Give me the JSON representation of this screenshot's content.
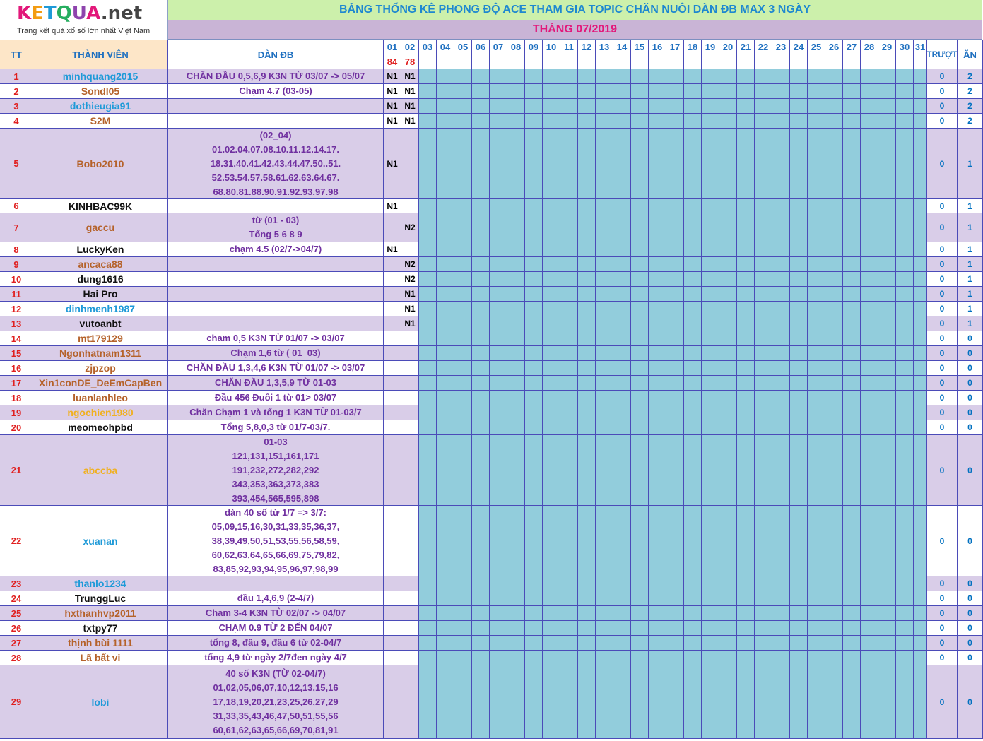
{
  "logo": {
    "brand": "KETQUA.net",
    "tagline": "Trang kết quả xổ số lớn nhất Việt Nam"
  },
  "title": "BẢNG THỐNG KÊ PHONG ĐỘ ACE THAM GIA TOPIC CHĂN NUÔI DÀN ĐB MAX 3 NGÀY",
  "month": "THÁNG 07/2019",
  "headers": {
    "tt": "TT",
    "member": "THÀNH VIÊN",
    "dan": "DÀN ĐB",
    "truot": "TRƯỢT",
    "an": "ĂN"
  },
  "days": [
    "01",
    "02",
    "03",
    "04",
    "05",
    "06",
    "07",
    "08",
    "09",
    "10",
    "11",
    "12",
    "13",
    "14",
    "15",
    "16",
    "17",
    "18",
    "19",
    "20",
    "21",
    "22",
    "23",
    "24",
    "25",
    "26",
    "27",
    "28",
    "29",
    "30",
    "31"
  ],
  "day_results": [
    "84",
    "78"
  ],
  "colors": {
    "title_bg": "#ccf0ab",
    "month_bg": "#c9b4d6",
    "header_bg": "#fde6c8",
    "result_bg": "#92cddc",
    "row_lavender": "#d9cde8",
    "row_white": "#ffffff",
    "grid_line": "#4b4bb8"
  },
  "rows": [
    {
      "tt": "1",
      "member": "minhquang2015",
      "member_color": "#1e9ad8",
      "dan": [
        "CHĂN ĐẦU 0,5,6,9 K3N TỪ 03/07 -> 05/07"
      ],
      "d1": "N1",
      "d2": "N1",
      "truot": "0",
      "an": "2"
    },
    {
      "tt": "2",
      "member": "Sondl05",
      "member_color": "#b5622a",
      "dan": [
        "Chạm 4.7 (03-05)"
      ],
      "d1": "N1",
      "d2": "N1",
      "truot": "0",
      "an": "2"
    },
    {
      "tt": "3",
      "member": "dothieugia91",
      "member_color": "#1e9ad8",
      "dan": [],
      "d1": "N1",
      "d2": "N1",
      "truot": "0",
      "an": "2"
    },
    {
      "tt": "4",
      "member": "S2M",
      "member_color": "#b5622a",
      "dan": [],
      "d1": "N1",
      "d2": "N1",
      "truot": "0",
      "an": "2"
    },
    {
      "tt": "5",
      "member": "Bobo2010",
      "member_color": "#b5622a",
      "dan": [
        "(02_04)",
        "01.02.04.07.08.10.11.12.14.17.",
        "18.31.40.41.42.43.44.47.50..51.",
        "52.53.54.57.58.61.62.63.64.67.",
        "68.80.81.88.90.91.92.93.97.98"
      ],
      "d1": "N1",
      "d2": "",
      "truot": "0",
      "an": "1"
    },
    {
      "tt": "6",
      "member": "KINHBAC99K",
      "member_color": "#111111",
      "dan": [],
      "d1": "N1",
      "d2": "",
      "truot": "0",
      "an": "1"
    },
    {
      "tt": "7",
      "member": "gaccu",
      "member_color": "#b5622a",
      "dan": [
        "từ (01 - 03)",
        "Tổng 5 6 8 9"
      ],
      "d1": "",
      "d2": "N2",
      "truot": "0",
      "an": "1"
    },
    {
      "tt": "8",
      "member": "LuckyKen",
      "member_color": "#111111",
      "dan": [
        "chạm 4.5 (02/7->04/7)"
      ],
      "d1": "N1",
      "d2": "",
      "truot": "0",
      "an": "1"
    },
    {
      "tt": "9",
      "member": "ancaca88",
      "member_color": "#b5622a",
      "dan": [],
      "d1": "",
      "d2": "N2",
      "truot": "0",
      "an": "1"
    },
    {
      "tt": "10",
      "member": "dung1616",
      "member_color": "#111111",
      "dan": [],
      "d1": "",
      "d2": "N2",
      "truot": "0",
      "an": "1"
    },
    {
      "tt": "11",
      "member": "Hai Pro",
      "member_color": "#111111",
      "dan": [],
      "d1": "",
      "d2": "N1",
      "truot": "0",
      "an": "1"
    },
    {
      "tt": "12",
      "member": "dinhmenh1987",
      "member_color": "#1e9ad8",
      "dan": [],
      "d1": "",
      "d2": "N1",
      "truot": "0",
      "an": "1"
    },
    {
      "tt": "13",
      "member": "vutoanbt",
      "member_color": "#111111",
      "dan": [],
      "d1": "",
      "d2": "N1",
      "truot": "0",
      "an": "1"
    },
    {
      "tt": "14",
      "member": "mt179129",
      "member_color": "#b5622a",
      "dan": [
        "cham 0,5 K3N TỪ 01/07 -> 03/07"
      ],
      "d1": "",
      "d2": "",
      "truot": "0",
      "an": "0"
    },
    {
      "tt": "15",
      "member": "Ngonhatnam1311",
      "member_color": "#b5622a",
      "dan": [
        "Chạm 1,6 từ ( 01_03)"
      ],
      "d1": "",
      "d2": "",
      "truot": "0",
      "an": "0"
    },
    {
      "tt": "16",
      "member": "zjpzop",
      "member_color": "#b5622a",
      "dan": [
        "CHĂN ĐẦU 1,3,4,6 K3N TỪ 01/07 -> 03/07"
      ],
      "d1": "",
      "d2": "",
      "truot": "0",
      "an": "0"
    },
    {
      "tt": "17",
      "member": "Xin1conDE_DeEmCapBen",
      "member_color": "#b5622a",
      "dan": [
        "CHĂN ĐẦU 1,3,5,9 TỪ 01-03"
      ],
      "d1": "",
      "d2": "",
      "truot": "0",
      "an": "0"
    },
    {
      "tt": "18",
      "member": "luanlanhleo",
      "member_color": "#b5622a",
      "dan": [
        "Đầu 456 Đuôi 1 từ 01> 03/07"
      ],
      "d1": "",
      "d2": "",
      "truot": "0",
      "an": "0"
    },
    {
      "tt": "19",
      "member": "ngochien1980",
      "member_color": "#f0b020",
      "dan": [
        "Chăn Chạm 1 và tổng 1 K3N TỪ 01-03/7"
      ],
      "d1": "",
      "d2": "",
      "truot": "0",
      "an": "0"
    },
    {
      "tt": "20",
      "member": "meomeohpbd",
      "member_color": "#111111",
      "dan": [
        "Tổng 5,8,0,3 từ 01/7-03/7."
      ],
      "d1": "",
      "d2": "",
      "truot": "0",
      "an": "0"
    },
    {
      "tt": "21",
      "member": "abccba",
      "member_color": "#f0b020",
      "dan": [
        "01-03",
        "121,131,151,161,171",
        "191,232,272,282,292",
        "343,353,363,373,383",
        "393,454,565,595,898"
      ],
      "d1": "",
      "d2": "",
      "truot": "0",
      "an": "0"
    },
    {
      "tt": "22",
      "member": "xuanan",
      "member_color": "#1e9ad8",
      "dan": [
        "dàn 40 số từ 1/7 => 3/7:",
        "05,09,15,16,30,31,33,35,36,37,",
        "38,39,49,50,51,53,55,56,58,59,",
        "60,62,63,64,65,66,69,75,79,82,",
        "83,85,92,93,94,95,96,97,98,99"
      ],
      "d1": "",
      "d2": "",
      "truot": "0",
      "an": "0"
    },
    {
      "tt": "23",
      "member": "thanlo1234",
      "member_color": "#1e9ad8",
      "dan": [],
      "d1": "",
      "d2": "",
      "truot": "0",
      "an": "0"
    },
    {
      "tt": "24",
      "member": "TrunggLuc",
      "member_color": "#111111",
      "dan": [
        "đầu 1,4,6,9 (2-4/7)"
      ],
      "d1": "",
      "d2": "",
      "truot": "0",
      "an": "0"
    },
    {
      "tt": "25",
      "member": "hxthanhvp2011",
      "member_color": "#b5622a",
      "dan": [
        "Cham 3-4 K3N TỪ 02/07 -> 04/07"
      ],
      "d1": "",
      "d2": "",
      "truot": "0",
      "an": "0"
    },
    {
      "tt": "26",
      "member": "txtpy77",
      "member_color": "#111111",
      "dan": [
        "CHẠM 0.9 TỪ 2 ĐẾN 04/07"
      ],
      "d1": "",
      "d2": "",
      "truot": "0",
      "an": "0"
    },
    {
      "tt": "27",
      "member": "thịnh bùi 1111",
      "member_color": "#b5622a",
      "dan": [
        "tổng 8, đầu 9, đầu 6 từ 02-04/7"
      ],
      "d1": "",
      "d2": "",
      "truot": "0",
      "an": "0"
    },
    {
      "tt": "28",
      "member": "Lã bất vi",
      "member_color": "#b5622a",
      "dan": [
        "tổng 4,9 từ ngày 2/7đen ngày 4/7"
      ],
      "d1": "",
      "d2": "",
      "truot": "0",
      "an": "0"
    },
    {
      "tt": "29",
      "member": "lobi",
      "member_color": "#1e9ad8",
      "dan": [
        "40 số K3N (TỪ 02-04/7)",
        "01,02,05,06,07,10,12,13,15,16",
        "17,18,19,20,21,23,25,26,27,29",
        "31,33,35,43,46,47,50,51,55,56",
        "60,61,62,63,65,66,69,70,81,91"
      ],
      "d1": "",
      "d2": "",
      "truot": "0",
      "an": "0"
    }
  ]
}
